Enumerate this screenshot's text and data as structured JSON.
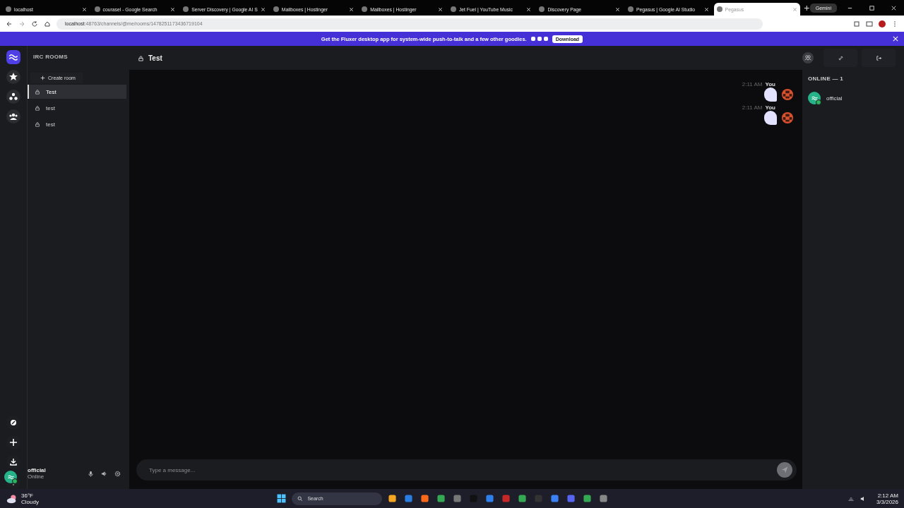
{
  "browser": {
    "tabs": [
      {
        "title": "localhost",
        "selected": false
      },
      {
        "title": "courasel - Google Search",
        "selected": false
      },
      {
        "title": "Server Discovery | Google AI S",
        "selected": false
      },
      {
        "title": "Mailboxes | Hostinger",
        "selected": false
      },
      {
        "title": "Mailboxes | Hostinger",
        "selected": false
      },
      {
        "title": "Jet Fuel | YouTube Music",
        "selected": false
      },
      {
        "title": "Discovery Page",
        "selected": false
      },
      {
        "title": "Pegasus | Google AI Studio",
        "selected": false
      },
      {
        "title": "Pegasus",
        "selected": true
      }
    ],
    "gemini": "Gemini",
    "url_host": "localhost",
    "url_rest": ":48763/channels/@me/rooms/1478251173436719104"
  },
  "banner": {
    "text": "Get the Fluxer desktop app for system-wide push-to-talk and a few other goodies.",
    "button": "Download"
  },
  "sidebar": {
    "heading": "IRC ROOMS",
    "create": "Create room",
    "rooms": [
      {
        "name": "Test",
        "selected": true
      },
      {
        "name": "test",
        "selected": false
      },
      {
        "name": "test",
        "selected": false
      }
    ]
  },
  "channel": {
    "title": "Test"
  },
  "messages": [
    {
      "time": "2:11 AM",
      "author": "You"
    },
    {
      "time": "2:11 AM",
      "author": "You"
    }
  ],
  "members": {
    "heading": "ONLINE — 1",
    "list": [
      {
        "name": "official"
      }
    ]
  },
  "composer": {
    "placeholder": "Type a message..."
  },
  "user": {
    "name": "official",
    "status": "Online"
  },
  "taskbar": {
    "temp": "36°F",
    "weather": "Cloudy",
    "search": "Search",
    "time": "2:12 AM",
    "date": "3/3/2026"
  }
}
